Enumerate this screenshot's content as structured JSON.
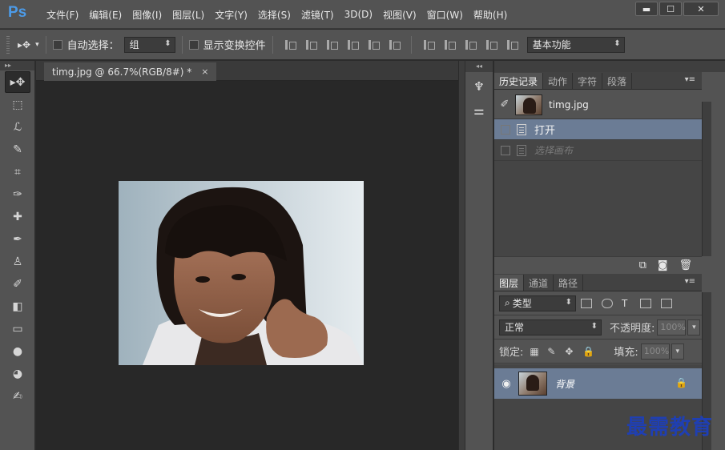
{
  "app": {
    "logo": "Ps"
  },
  "menu": [
    "文件(F)",
    "编辑(E)",
    "图像(I)",
    "图层(L)",
    "文字(Y)",
    "选择(S)",
    "滤镜(T)",
    "3D(D)",
    "视图(V)",
    "窗口(W)",
    "帮助(H)"
  ],
  "window_controls": {
    "minimize": "▬",
    "maximize": "☐",
    "close": "✕"
  },
  "options": {
    "auto_select_label": "自动选择：",
    "auto_select_value": "组",
    "show_transform_label": "显示变换控件",
    "workspace": "基本功能"
  },
  "document": {
    "tab_title": "timg.jpg @ 66.7%(RGB/8#) *",
    "tab_close": "×"
  },
  "history": {
    "tabs": [
      "历史记录",
      "动作",
      "字符",
      "段落"
    ],
    "snapshot_name": "timg.jpg",
    "steps": [
      {
        "label": "打开",
        "selected": true
      },
      {
        "label": "选择画布",
        "selected": false
      }
    ]
  },
  "layers": {
    "tabs": [
      "图层",
      "通道",
      "路径"
    ],
    "filter_type": "类型",
    "blend_mode": "正常",
    "opacity_label": "不透明度:",
    "opacity_value": "100%",
    "lock_label": "锁定:",
    "fill_label": "填充:",
    "fill_value": "100%",
    "items": [
      {
        "name": "背景",
        "visible": true,
        "locked": true
      }
    ]
  },
  "watermark": "最需教育",
  "colors": {
    "accent_ps": "#4c9be8",
    "selection": "#6b7c95",
    "panel": "#535353",
    "canvas": "#282828",
    "watermark": "#1f3fb3"
  }
}
